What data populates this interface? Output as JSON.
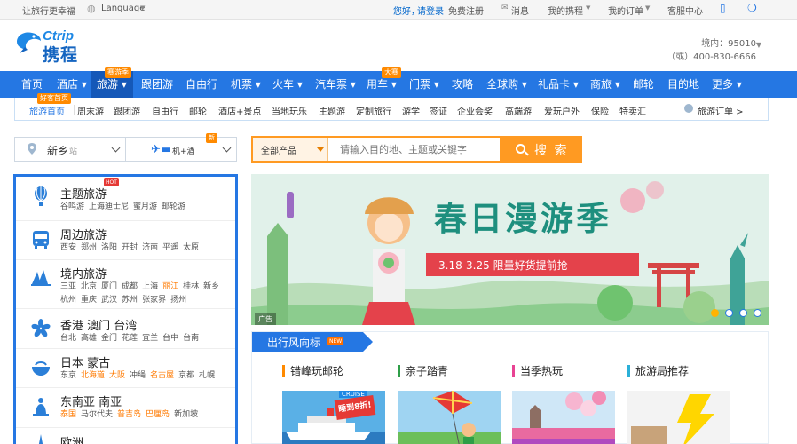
{
  "topbar": {
    "slogan": "让旅行更幸福",
    "language": "Language",
    "greeting": "您好，",
    "login": "请登录",
    "register": "免费注册",
    "messages": "消息",
    "my_trips": "我的携程",
    "my_orders": "我的订单",
    "customer_service": "客服中心"
  },
  "header": {
    "logo_en": "Ctrip",
    "logo_cn": "携程",
    "hotline_line1": "境内：95010",
    "hotline_line2": "（或）400-830-6666"
  },
  "main_nav": {
    "items": [
      "首页",
      "酒店",
      "旅游",
      "跟团游",
      "自由行",
      "机票",
      "火车",
      "汽车票",
      "用车",
      "门票",
      "攻略",
      "全球购",
      "礼品卡",
      "商旅",
      "邮轮",
      "目的地",
      "更多"
    ],
    "active": "旅游",
    "badges": [
      "赛游季",
      "大赛"
    ]
  },
  "sub_nav": {
    "badge": "好客首页",
    "items": [
      "旅游首页",
      "周末游",
      "跟团游",
      "自由行",
      "邮轮",
      "酒店+景点",
      "当地玩乐",
      "主题游",
      "定制旅行",
      "游学",
      "签证",
      "企业会奖",
      "高端游",
      "爱玩户外",
      "保险",
      "特卖汇"
    ],
    "orders": "旅游订单 >"
  },
  "selectors": {
    "city": "新乡",
    "city_suffix": "站",
    "transport_label": "机+酒",
    "transport_badge": "新"
  },
  "search": {
    "category": "全部产品",
    "placeholder": "请输入目的地、主题或关键字",
    "button": "搜 索"
  },
  "categories": [
    {
      "icon": "balloon-icon",
      "title": "主题旅游",
      "badge": "HOT",
      "links": [
        [
          "谷鸣游",
          false
        ],
        [
          "上海迪士尼",
          false
        ],
        [
          "蜜月游",
          false
        ],
        [
          "邮轮游",
          false
        ]
      ]
    },
    {
      "icon": "bus-icon",
      "title": "周边旅游",
      "links": [
        [
          "西安",
          false
        ],
        [
          "郑州",
          false
        ],
        [
          "洛阳",
          false
        ],
        [
          "开封",
          false
        ],
        [
          "济南",
          false
        ],
        [
          "平遥",
          false
        ],
        [
          "太原",
          false
        ]
      ]
    },
    {
      "icon": "opera-house-icon",
      "title": "境内旅游",
      "links": [
        [
          "三亚",
          false
        ],
        [
          "北京",
          false
        ],
        [
          "厦门",
          false
        ],
        [
          "成都",
          false
        ],
        [
          "上海",
          false
        ],
        [
          "丽江",
          true
        ],
        [
          "桂林",
          false
        ],
        [
          "新乡",
          false
        ],
        [
          "杭州",
          false
        ],
        [
          "重庆",
          false
        ],
        [
          "武汉",
          false
        ],
        [
          "苏州",
          false
        ],
        [
          "张家界",
          false
        ],
        [
          "扬州",
          false
        ]
      ]
    },
    {
      "icon": "bauhinia-icon",
      "title": "香港 澳门 台湾",
      "links": [
        [
          "台北",
          false
        ],
        [
          "高雄",
          false
        ],
        [
          "金门",
          false
        ],
        [
          "花莲",
          false
        ],
        [
          "宜兰",
          false
        ],
        [
          "台中",
          false
        ],
        [
          "台南",
          false
        ]
      ]
    },
    {
      "icon": "bowl-icon",
      "title": "日本 蒙古",
      "links": [
        [
          "东京",
          false
        ],
        [
          "北海道",
          true
        ],
        [
          "大阪",
          true
        ],
        [
          "冲绳",
          false
        ],
        [
          "名古屋",
          true
        ],
        [
          "京都",
          false
        ],
        [
          "札幌",
          false
        ]
      ]
    },
    {
      "icon": "buddha-icon",
      "title": "东南亚 南亚",
      "links": [
        [
          "泰国",
          true
        ],
        [
          "马尔代夫",
          false
        ],
        [
          "普吉岛",
          true
        ],
        [
          "巴厘岛",
          true
        ],
        [
          "新加坡",
          false
        ]
      ]
    },
    {
      "icon": "tower-icon",
      "title": "欧洲",
      "links": []
    }
  ],
  "banner": {
    "title": "春日漫游季",
    "ribbon": "3.18-3.25  限量好货提前抢",
    "ad_tag": "广告"
  },
  "trends": {
    "title": "出行风向标",
    "badge": "NEW",
    "cards": [
      {
        "title": "错峰玩邮轮",
        "color": "#ff8a00",
        "tag_top": "CRUISE",
        "tag": "睡到8折!"
      },
      {
        "title": "亲子踏青",
        "color": "#2e9e48"
      },
      {
        "title": "当季热玩",
        "color": "#e84393"
      },
      {
        "title": "旅游局推荐",
        "color": "#2bb0d8"
      }
    ]
  },
  "colors": {
    "brand_blue": "#2577e3",
    "accent_orange": "#ff9a22",
    "highlight_orange": "#ff7a00"
  }
}
